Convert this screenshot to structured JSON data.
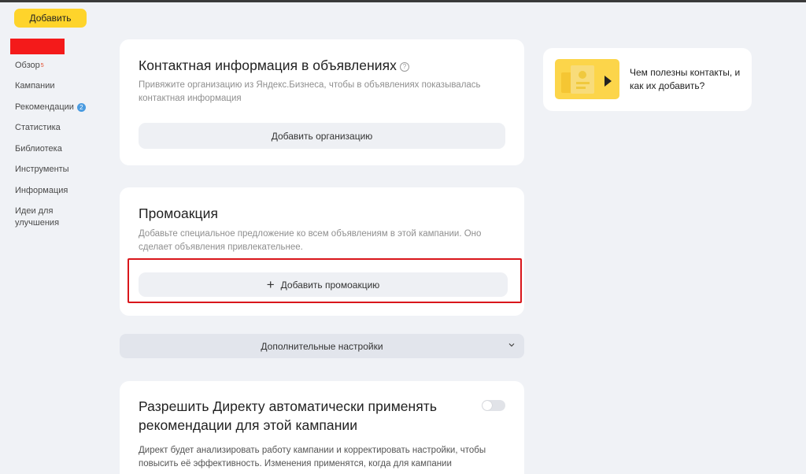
{
  "sidebar": {
    "add_button": "Добавить",
    "items": [
      {
        "label": "Обзор",
        "sup": "5"
      },
      {
        "label": "Кампании"
      },
      {
        "label": "Рекомендации",
        "badge": "2"
      },
      {
        "label": "Статистика"
      },
      {
        "label": "Библиотека"
      },
      {
        "label": "Инструменты"
      },
      {
        "label": "Информация"
      },
      {
        "label": "Идеи для улучшения"
      }
    ]
  },
  "contact_card": {
    "title": "Контактная информация в объявлениях",
    "help_glyph": "?",
    "description": "Привяжите организацию из Яндекс.Бизнеса, чтобы в объявлениях показывалась контактная информация",
    "button": "Добавить организацию"
  },
  "promo_card": {
    "title": "Промоакция",
    "description": "Добавьте специальное предложение ко всем объявлениям в этой кампании. Оно сделает объявления привлекательнее.",
    "button": "Добавить промоакцию",
    "button_icon": "plus-icon"
  },
  "settings_bar": {
    "label": "Дополнительные настройки",
    "icon": "chevron-down-icon"
  },
  "auto_card": {
    "title": "Разрешить Директу автоматически применять рекомендации для этой кампании",
    "toggle_on": false,
    "description": "Директ будет анализировать работу кампании и корректировать настройки, чтобы повысить её эффективность. Изменения применятся, когда для кампании"
  },
  "video_card": {
    "text": "Чем полезны контакты, и как их добавить?",
    "icon": "play-icon"
  },
  "colors": {
    "accent_yellow": "#fed42b",
    "highlight_red": "#d9161b",
    "badge_blue": "#4a9be0",
    "background": "#f0f2f6"
  }
}
